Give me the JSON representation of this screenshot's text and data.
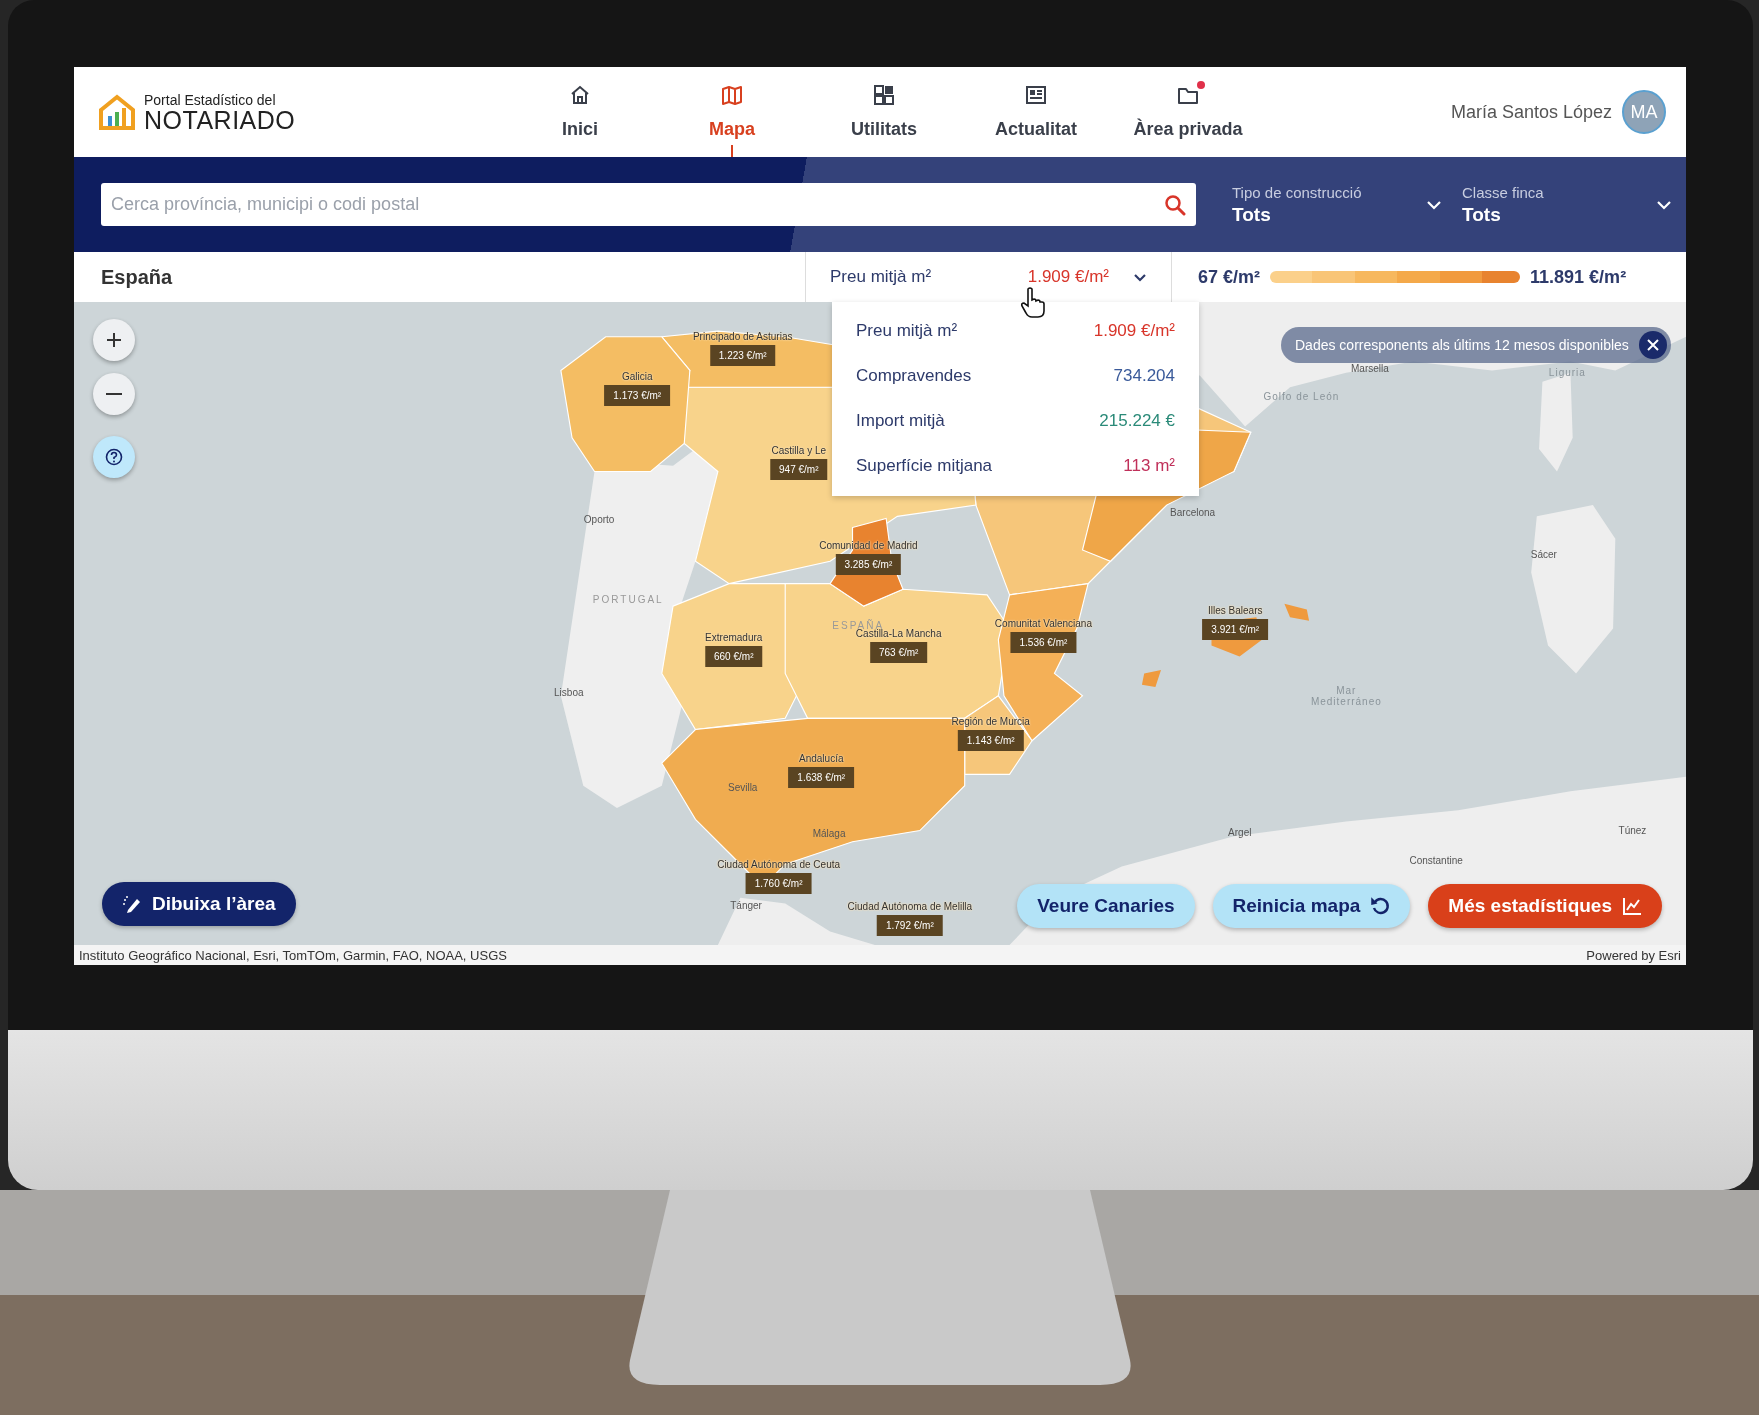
{
  "header": {
    "logo": {
      "subtitle": "Portal Estadístico del",
      "title": "NOTARIADO"
    },
    "nav": [
      {
        "label": "Inici",
        "selected": false,
        "notification": false
      },
      {
        "label": "Mapa",
        "selected": true,
        "notification": false
      },
      {
        "label": "Utilitats",
        "selected": false,
        "notification": false
      },
      {
        "label": "Actualitat",
        "selected": false,
        "notification": false
      },
      {
        "label": "Àrea privada",
        "selected": false,
        "notification": true
      }
    ],
    "user": {
      "name": "María Santos López",
      "initials": "MA"
    }
  },
  "filters": {
    "search": {
      "placeholder": "Cerca província, municipi o codi postal"
    },
    "selects": [
      {
        "label": "Tipo de construcció",
        "value": "Tots"
      },
      {
        "label": "Classe finca",
        "value": "Tots"
      }
    ]
  },
  "area": {
    "title": "España",
    "metric": {
      "label": "Preu mitjà m²",
      "value": "1.909 €/m²",
      "color": "#d8352a"
    },
    "metric_options": [
      {
        "label": "Preu mitjà m²",
        "value": "1.909 €/m²",
        "color": "#d8352a"
      },
      {
        "label": "Compravendes",
        "value": "734.204",
        "color": "#3a5a9a"
      },
      {
        "label": "Import mitjà",
        "value": "215.224 €",
        "color": "#2a8a78"
      },
      {
        "label": "Superfície mitjana",
        "value": "113 m²",
        "color": "#c0305a"
      }
    ],
    "legend": {
      "min": "67 €/m²",
      "max": "11.891 €/m²"
    }
  },
  "map": {
    "notice": "Dades corresponents als últims 12 mesos disponibles",
    "regions": [
      {
        "name": "Principado de Asturias",
        "value": "1.223 €/m²"
      },
      {
        "name": "Galicia",
        "value": "1.173 €/m²"
      },
      {
        "name": "Castilla y Le",
        "value": "947 €/m²"
      },
      {
        "name": "Comunidad de Madrid",
        "value": "3.285 €/m²"
      },
      {
        "name": "Extremadura",
        "value": "660 €/m²"
      },
      {
        "name": "Castilla-La Mancha",
        "value": "763 €/m²"
      },
      {
        "name": "Comunitat Valenciana",
        "value": "1.536 €/m²"
      },
      {
        "name": "Illes Balears",
        "value": "3.921 €/m²"
      },
      {
        "name": "Región de Murcia",
        "value": "1.143 €/m²"
      },
      {
        "name": "Andalucía",
        "value": "1.638 €/m²"
      },
      {
        "name": "Ciudad Autónoma de Ceuta",
        "value": "1.760 €/m²"
      },
      {
        "name": "Ciudad Autónoma de Melilla",
        "value": "1.792 €/m²"
      }
    ],
    "places": [
      {
        "name": "Oporto",
        "kind": "city"
      },
      {
        "name": "PORTUGAL",
        "kind": "country"
      },
      {
        "name": "ESPAÑA",
        "kind": "country"
      },
      {
        "name": "Lisboa",
        "kind": "city"
      },
      {
        "name": "Sevilla",
        "kind": "city"
      },
      {
        "name": "Málaga",
        "kind": "city"
      },
      {
        "name": "Tánger",
        "kind": "city"
      },
      {
        "name": "Barcelona",
        "kind": "city"
      },
      {
        "name": "Marsella",
        "kind": "city"
      },
      {
        "name": "Golfo de León",
        "kind": "sea"
      },
      {
        "name": "Liguria",
        "kind": "sea"
      },
      {
        "name": "Sácer",
        "kind": "city"
      },
      {
        "name": "Mar Mediterráneo",
        "kind": "sea"
      },
      {
        "name": "Argel",
        "kind": "city"
      },
      {
        "name": "Constantine",
        "kind": "city"
      },
      {
        "name": "Túnez",
        "kind": "city"
      }
    ],
    "buttons": [
      {
        "label": "Dibuixa l’àrea",
        "kind": "draw"
      },
      {
        "label": "Veure Canaries",
        "kind": "plain"
      },
      {
        "label": "Reinicia mapa",
        "kind": "reset"
      },
      {
        "label": "Més estadístiques",
        "kind": "stats"
      }
    ],
    "attribution": "Instituto Geográfico Nacional, Esri, TomTOm, Garmin, FAO, NOAA, USGS",
    "powered_by": "Powered by Esri"
  }
}
